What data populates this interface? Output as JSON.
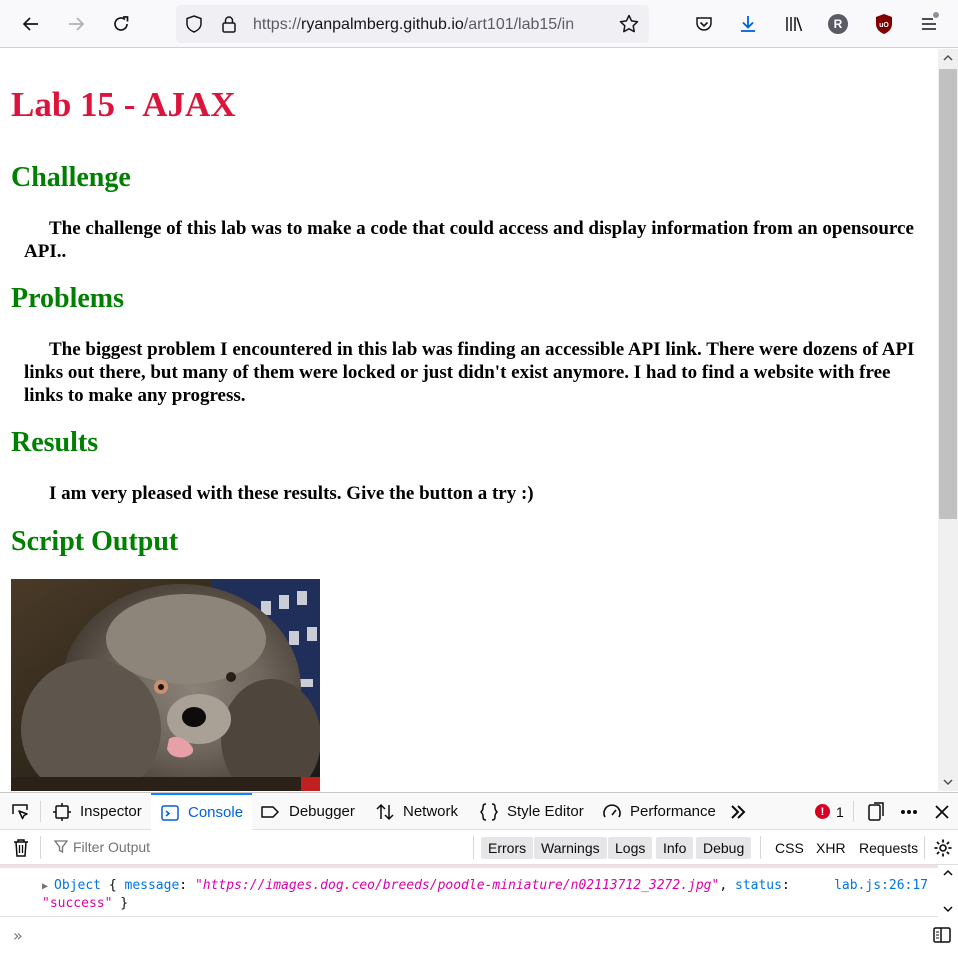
{
  "browser": {
    "url_scheme": "https://",
    "url_host": "ryanpalmberg.github.io",
    "url_path": "/art101/lab15/in",
    "profile_initial": "R"
  },
  "page": {
    "title": "Lab 15 - AJAX",
    "sections": [
      {
        "heading": "Challenge",
        "text": "The challenge of this lab was to make a code that could access and display information from an opensource API.."
      },
      {
        "heading": "Problems",
        "text": "The biggest problem I encountered in this lab was finding an accessible API link. There were dozens of API links out there, but many of them were locked or just didn't exist anymore. I had to find a website with free links to make any progress."
      },
      {
        "heading": "Results",
        "text": "I am very pleased with these results. Give the button a try :)"
      },
      {
        "heading": "Script Output",
        "text": ""
      }
    ]
  },
  "devtools": {
    "tabs": [
      {
        "label": "Inspector",
        "icon": "inspector-icon"
      },
      {
        "label": "Console",
        "icon": "console-icon",
        "active": true
      },
      {
        "label": "Debugger",
        "icon": "debugger-icon"
      },
      {
        "label": "Network",
        "icon": "network-icon"
      },
      {
        "label": "Style Editor",
        "icon": "style-editor-icon"
      },
      {
        "label": "Performance",
        "icon": "performance-icon"
      }
    ],
    "error_count": "1",
    "filter_placeholder": "Filter Output",
    "filter_buttons": [
      "Errors",
      "Warnings",
      "Logs",
      "Info",
      "Debug"
    ],
    "filter_plain": [
      "CSS",
      "XHR",
      "Requests"
    ],
    "log": {
      "object_label": "Object",
      "open_brace": " { ",
      "message_key": "message",
      "message_value": "\"https://images.dog.ceo/breeds/poodle-miniature/n02113712_3272.jpg\"",
      "status_key": "status",
      "status_value": "\"success\"",
      "close_brace": " }",
      "location": "lab.js:26:17"
    }
  },
  "colors": {
    "title": "#dc143c",
    "heading": "#008000",
    "devtools_accent": "#0060df",
    "error": "#d70022"
  }
}
